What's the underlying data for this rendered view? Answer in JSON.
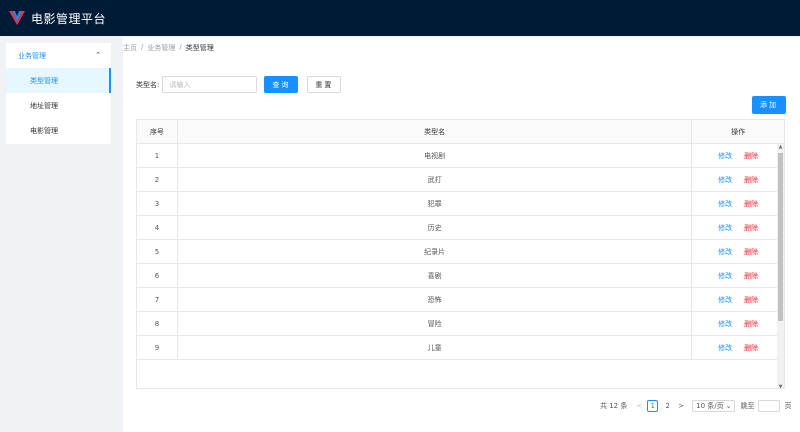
{
  "app": {
    "title": "电影管理平台",
    "logo_icon": "v-logo-icon"
  },
  "sidebar": {
    "group_label": "业务管理",
    "items": [
      {
        "label": "类型管理",
        "active": true
      },
      {
        "label": "地址管理",
        "active": false
      },
      {
        "label": "电影管理",
        "active": false
      }
    ]
  },
  "breadcrumb": {
    "home": "主页",
    "sep1": "/",
    "parent": "业务管理",
    "sep2": "/",
    "current": "类型管理"
  },
  "search": {
    "label": "类型名:",
    "placeholder": "请输入",
    "value": "",
    "query_label": "查询",
    "reset_label": "重置"
  },
  "toolbar": {
    "add_label": "添加"
  },
  "table": {
    "headers": {
      "index": "序号",
      "name": "类型名",
      "actions": "操作"
    },
    "edit_label": "修改",
    "delete_label": "删除",
    "rows": [
      {
        "index": "1",
        "name": "电视剧"
      },
      {
        "index": "2",
        "name": "武打"
      },
      {
        "index": "3",
        "name": "犯罪"
      },
      {
        "index": "4",
        "name": "历史"
      },
      {
        "index": "5",
        "name": "纪录片"
      },
      {
        "index": "6",
        "name": "喜剧"
      },
      {
        "index": "7",
        "name": "恐怖"
      },
      {
        "index": "8",
        "name": "冒险"
      },
      {
        "index": "9",
        "name": "儿童"
      }
    ]
  },
  "pagination": {
    "total": "共 12 条",
    "pages": [
      "1",
      "2"
    ],
    "current_page": "1",
    "prev_icon": "chevron-left-icon",
    "next_icon": "chevron-right-icon",
    "page_size": "10 条/页",
    "jump_prefix": "跳至",
    "jump_suffix": "页",
    "jump_value": ""
  },
  "colors": {
    "header_bg": "#001b36",
    "primary": "#1890ff",
    "danger": "#f5222d",
    "page_bg": "#f0f2f5"
  }
}
